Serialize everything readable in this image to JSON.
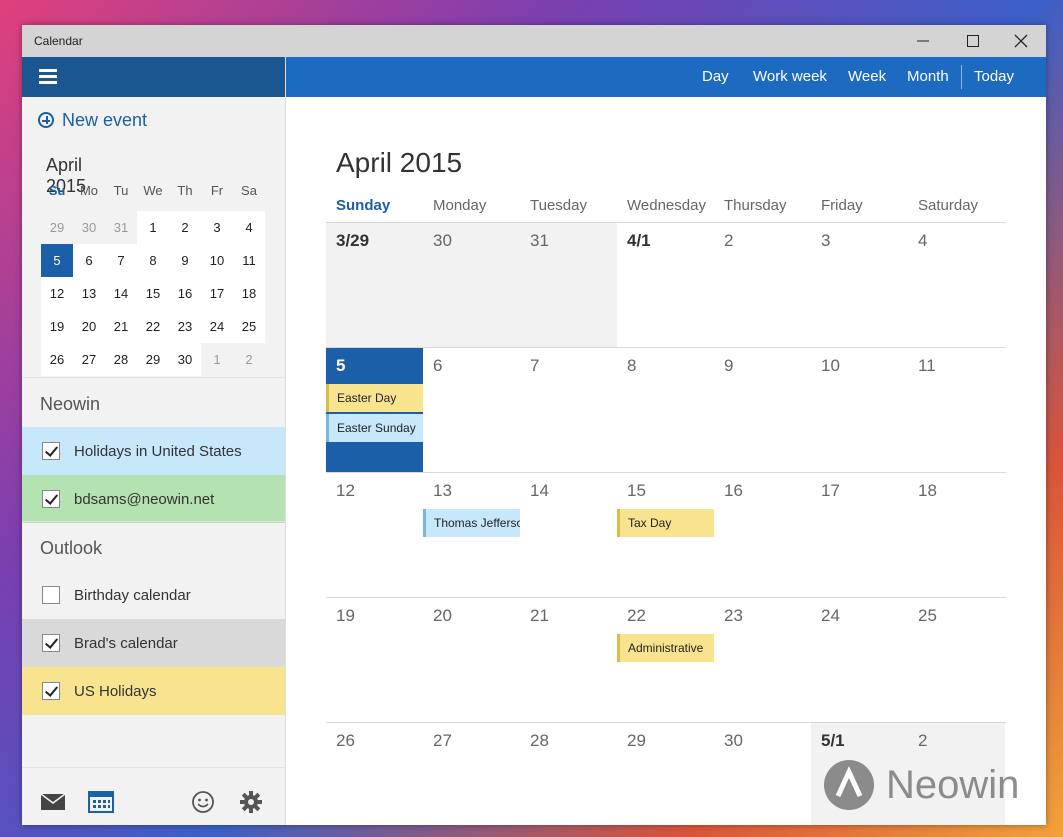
{
  "window": {
    "title": "Calendar"
  },
  "sidebar": {
    "new_event_label": "New event",
    "mini_calendar": {
      "title": "April 2015",
      "weekdays": [
        "Su",
        "Mo",
        "Tu",
        "We",
        "Th",
        "Fr",
        "Sa"
      ],
      "weeks": [
        [
          "29",
          "30",
          "31",
          "1",
          "2",
          "3",
          "4"
        ],
        [
          "5",
          "6",
          "7",
          "8",
          "9",
          "10",
          "11"
        ],
        [
          "12",
          "13",
          "14",
          "15",
          "16",
          "17",
          "18"
        ],
        [
          "19",
          "20",
          "21",
          "22",
          "23",
          "24",
          "25"
        ],
        [
          "26",
          "27",
          "28",
          "29",
          "30",
          "1",
          "2"
        ]
      ]
    },
    "groups": [
      {
        "title": "Neowin",
        "calendars": [
          {
            "label": "Holidays in United States",
            "checked": true,
            "color": "#c7e8fb"
          },
          {
            "label": "bdsams@neowin.net",
            "checked": true,
            "color": "#b4e2b0"
          }
        ]
      },
      {
        "title": "Outlook",
        "calendars": [
          {
            "label": "Birthday calendar",
            "checked": false,
            "color": "#f2f2f2"
          },
          {
            "label": "Brad's calendar",
            "checked": true,
            "color": "#d9d9d9"
          },
          {
            "label": "US Holidays",
            "checked": true,
            "color": "#f8e48e"
          }
        ]
      }
    ],
    "footer_icons": [
      "mail-icon",
      "calendar-icon",
      "smiley-icon",
      "gear-icon"
    ]
  },
  "toolbar": {
    "views": [
      "Day",
      "Work week",
      "Week",
      "Month"
    ],
    "today_label": "Today"
  },
  "main": {
    "month_title": "April 2015",
    "weekdays": [
      "Sunday",
      "Monday",
      "Tuesday",
      "Wednesday",
      "Thursday",
      "Friday",
      "Saturday"
    ],
    "weeks": [
      [
        "3/29",
        "30",
        "31",
        "4/1",
        "2",
        "3",
        "4"
      ],
      [
        "5",
        "6",
        "7",
        "8",
        "9",
        "10",
        "11"
      ],
      [
        "12",
        "13",
        "14",
        "15",
        "16",
        "17",
        "18"
      ],
      [
        "19",
        "20",
        "21",
        "22",
        "23",
        "24",
        "25"
      ],
      [
        "26",
        "27",
        "28",
        "29",
        "30",
        "5/1",
        "2"
      ]
    ],
    "events": [
      {
        "week": 1,
        "day": 0,
        "slot": 0,
        "label": "Easter Day",
        "color": "yellow"
      },
      {
        "week": 1,
        "day": 0,
        "slot": 1,
        "label": "Easter Sunday",
        "color": "blue"
      },
      {
        "week": 2,
        "day": 1,
        "slot": 0,
        "label": "Thomas Jefferson",
        "color": "blue"
      },
      {
        "week": 2,
        "day": 3,
        "slot": 0,
        "label": "Tax Day",
        "color": "yellow"
      },
      {
        "week": 3,
        "day": 3,
        "slot": 0,
        "label": "Administrative",
        "color": "yellow"
      }
    ]
  },
  "watermark": {
    "text": "Neowin"
  }
}
